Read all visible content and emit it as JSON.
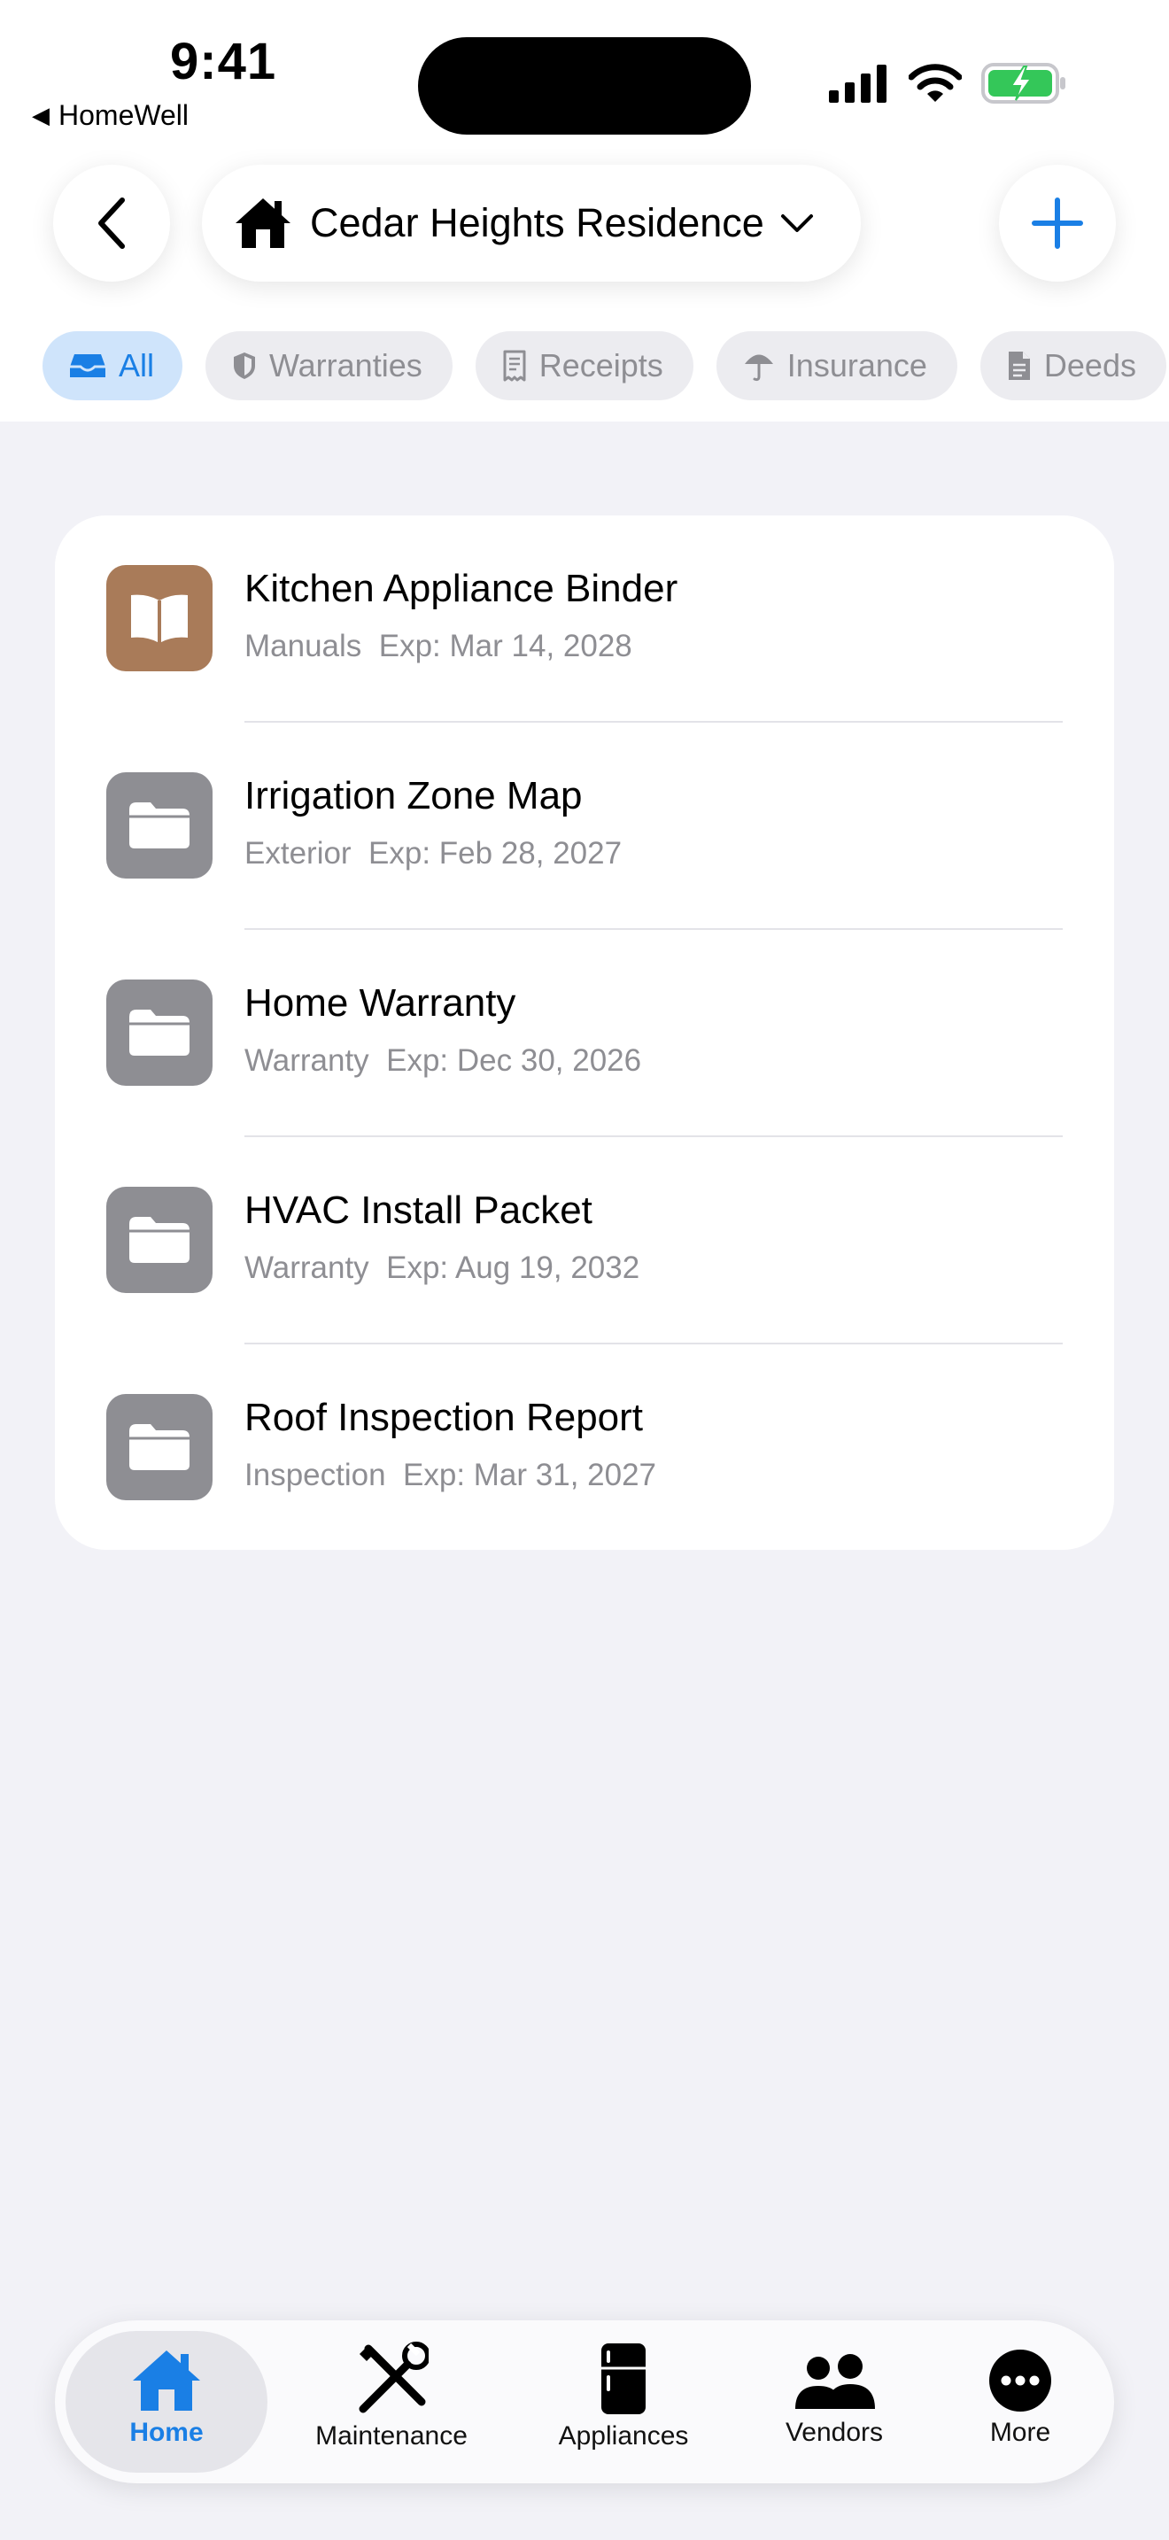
{
  "status_bar": {
    "time": "9:41",
    "back_app": "HomeWell"
  },
  "header": {
    "title": "Cedar Heights Residence"
  },
  "filters": [
    {
      "label": "All",
      "icon": "tray-icon",
      "active": true
    },
    {
      "label": "Warranties",
      "icon": "shield-icon",
      "active": false
    },
    {
      "label": "Receipts",
      "icon": "receipt-icon",
      "active": false
    },
    {
      "label": "Insurance",
      "icon": "umbrella-icon",
      "active": false
    },
    {
      "label": "Deeds",
      "icon": "document-icon",
      "active": false
    }
  ],
  "documents": [
    {
      "name": "Kitchen Appliance Binder",
      "category": "Manuals",
      "expiry": "Exp: Mar 14, 2028",
      "icon": "book-icon"
    },
    {
      "name": "Irrigation Zone Map",
      "category": "Exterior",
      "expiry": "Exp: Feb 28, 2027",
      "icon": "folder-icon"
    },
    {
      "name": "Home Warranty",
      "category": "Warranty",
      "expiry": "Exp: Dec 30, 2026",
      "icon": "folder-icon"
    },
    {
      "name": "HVAC Install Packet",
      "category": "Warranty",
      "expiry": "Exp: Aug 19, 2032",
      "icon": "folder-icon"
    },
    {
      "name": "Roof Inspection Report",
      "category": "Inspection",
      "expiry": "Exp: Mar 31, 2027",
      "icon": "folder-icon"
    }
  ],
  "tabs": [
    {
      "label": "Home",
      "icon": "house-icon",
      "active": true
    },
    {
      "label": "Maintenance",
      "icon": "tools-icon",
      "active": false
    },
    {
      "label": "Appliances",
      "icon": "refrigerator-icon",
      "active": false
    },
    {
      "label": "Vendors",
      "icon": "people-icon",
      "active": false
    },
    {
      "label": "More",
      "icon": "ellipsis-icon",
      "active": false
    }
  ],
  "colors": {
    "accent": "#1a7fe5",
    "battery": "#34c759",
    "tile_gray": "#8e8e93",
    "tile_brown": "#a97b59"
  }
}
